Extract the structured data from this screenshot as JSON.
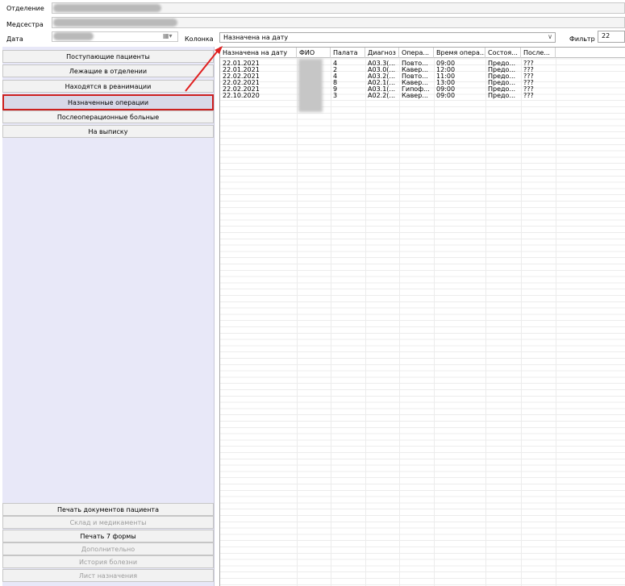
{
  "form": {
    "department_label": "Отделение",
    "nurse_label": "Медсестра",
    "date_label": "Дата",
    "column_label": "Колонка",
    "column_value": "Назначена на дату",
    "filter_label": "Фильтр",
    "filter_value": "22"
  },
  "nav": {
    "items": [
      {
        "label": "Поступающие пациенты",
        "state": "normal"
      },
      {
        "label": "Лежащие в отделении",
        "state": "normal"
      },
      {
        "label": "Находятся в реанимации",
        "state": "normal"
      },
      {
        "label": "Назначенные операции",
        "state": "selected"
      },
      {
        "label": "Послеоперационные больные",
        "state": "normal"
      },
      {
        "label": "На выписку",
        "state": "normal"
      }
    ],
    "bottom_items": [
      {
        "label": "Печать документов пациента",
        "state": "normal"
      },
      {
        "label": "Склад и медикаменты",
        "state": "disabled"
      },
      {
        "label": "Печать 7 формы",
        "state": "normal"
      },
      {
        "label": "Дополнительно",
        "state": "disabled"
      },
      {
        "label": "История болезни",
        "state": "disabled"
      },
      {
        "label": "Лист назначения",
        "state": "disabled"
      }
    ]
  },
  "table": {
    "columns": [
      "Назначена на дату",
      "ФИО",
      "Палата",
      "Диагноз",
      "Опера...",
      "Время опера...",
      "Состоя...",
      "После..."
    ],
    "rows": [
      [
        "22.01.2021",
        "",
        "4",
        "A03.3(...",
        "Повто...",
        "09:00",
        "Предо...",
        "???"
      ],
      [
        "22.01.2021",
        "",
        "2",
        "A03.0(...",
        "Кавер...",
        "12:00",
        "Предо...",
        "???"
      ],
      [
        "22.02.2021",
        "",
        "4",
        "A03.2(...",
        "Повто...",
        "11:00",
        "Предо...",
        "???"
      ],
      [
        "22.02.2021",
        "",
        "8",
        "A02.1(...",
        "Кавер...",
        "13:00",
        "Предо...",
        "???"
      ],
      [
        "22.02.2021",
        "",
        "9",
        "A03.1(...",
        "Гипоф...",
        "09:00",
        "Предо...",
        "???"
      ],
      [
        "22.10.2020",
        "",
        "3",
        "A02.2(...",
        "Кавер...",
        "09:00",
        "Предо...",
        "???"
      ]
    ]
  },
  "annotation": {
    "arrow_color": "#e02020",
    "highlight_color": "#cc1f1f"
  }
}
